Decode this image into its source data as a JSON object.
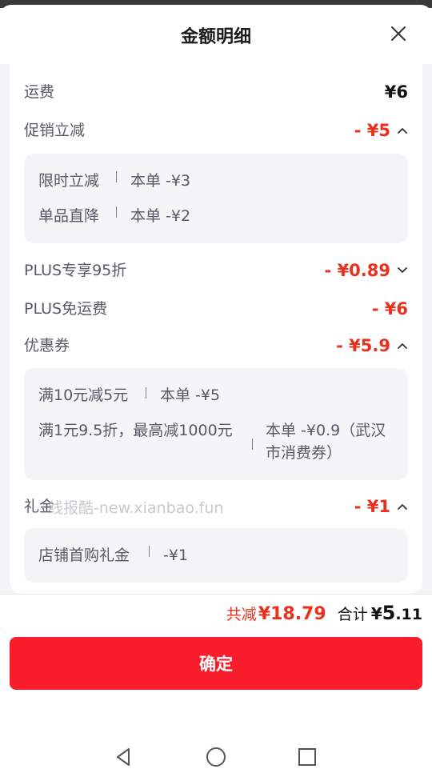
{
  "header": {
    "title": "金额明细"
  },
  "rows": {
    "shipping": {
      "label": "运费",
      "amount": "¥6"
    },
    "promo": {
      "label": "促销立减",
      "amount": "- ¥5",
      "items": [
        {
          "name": "限时立减",
          "detail": "本单 -¥3"
        },
        {
          "name": "单品直降",
          "detail": "本单 -¥2"
        }
      ]
    },
    "plus_discount": {
      "label": "PLUS专享95折",
      "amount": "- ¥0.89"
    },
    "plus_shipping": {
      "label": "PLUS免运费",
      "amount": "- ¥6"
    },
    "coupon": {
      "label": "优惠券",
      "amount": "- ¥5.9",
      "items": [
        {
          "name": "满10元减5元",
          "detail": "本单 -¥5"
        },
        {
          "name": "满1元9.5折，最高减1000元",
          "detail_line1": "本单 -¥0.9（武汉",
          "detail_line2": "市消费券）"
        }
      ]
    },
    "gift": {
      "label": "礼金",
      "amount": "- ¥1",
      "items": [
        {
          "name": "店铺首购礼金",
          "detail": "-¥1"
        }
      ]
    }
  },
  "watermark": "线报酷-new.xianbao.fun",
  "summary": {
    "reduce_label": "共减",
    "reduce_value": "¥18.79",
    "total_label": "合计",
    "total_currency": "¥",
    "total_int": "5",
    "total_dec": ".11"
  },
  "confirm_label": "确定",
  "icons": {
    "close": "close-icon",
    "chevron_up": "chevron-up-icon",
    "chevron_down": "chevron-down-icon",
    "nav_back": "nav-back-icon",
    "nav_home": "nav-home-icon",
    "nav_recent": "nav-recent-icon"
  },
  "colors": {
    "accent_red": "#e8301c",
    "button_red": "#fa1e2c"
  }
}
